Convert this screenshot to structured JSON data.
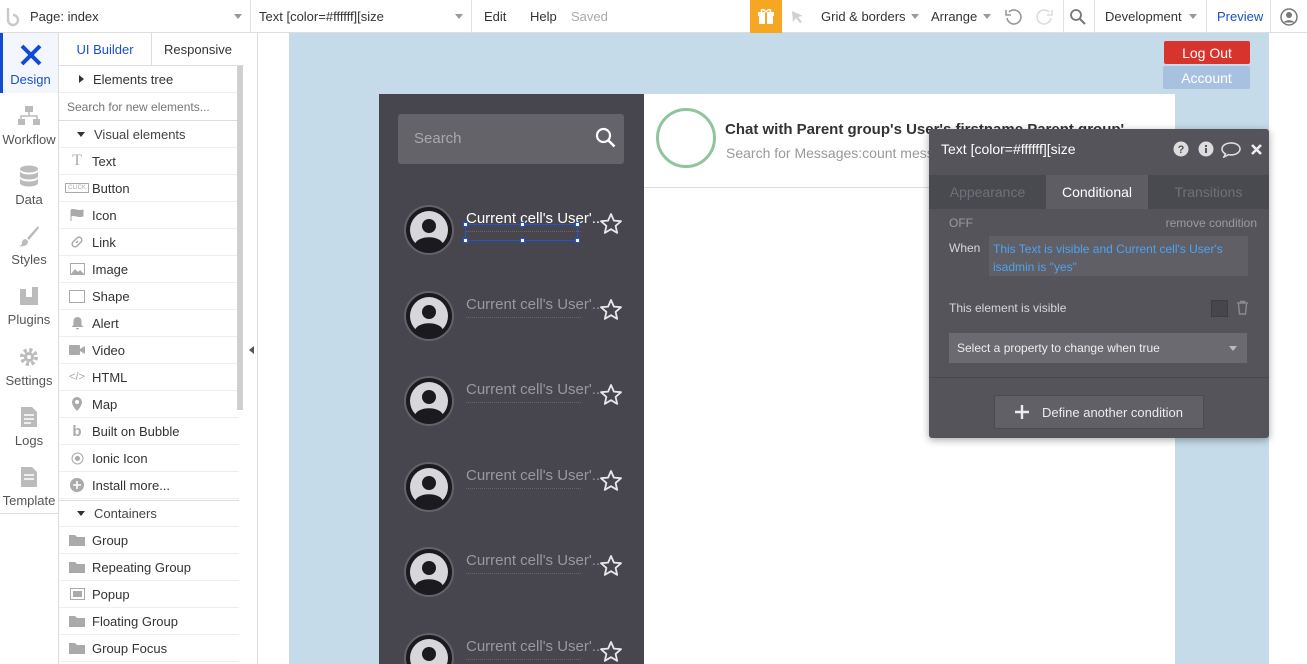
{
  "topbar": {
    "page_selector": "Page: index",
    "element_selector": "Text [color=#ffffff][size",
    "menu_edit": "Edit",
    "menu_help": "Help",
    "save_status": "Saved",
    "grid_borders": "Grid & borders",
    "arrange": "Arrange",
    "environment": "Development",
    "preview": "Preview"
  },
  "rail": {
    "items": [
      {
        "label": "Design",
        "icon": "design-icon"
      },
      {
        "label": "Workflow",
        "icon": "workflow-icon"
      },
      {
        "label": "Data",
        "icon": "database-icon"
      },
      {
        "label": "Styles",
        "icon": "brush-icon"
      },
      {
        "label": "Plugins",
        "icon": "plugin-icon"
      },
      {
        "label": "Settings",
        "icon": "gear-icon"
      },
      {
        "label": "Logs",
        "icon": "document-icon"
      },
      {
        "label": "Template",
        "icon": "template-icon"
      }
    ]
  },
  "panel": {
    "tab_ui_builder": "UI Builder",
    "tab_responsive": "Responsive",
    "elements_tree": "Elements tree",
    "search_placeholder": "Search for new elements...",
    "visual_elements_heading": "Visual elements",
    "visual_elements": [
      {
        "label": "Text",
        "icon": "T"
      },
      {
        "label": "Button",
        "icon": "CLICK"
      },
      {
        "label": "Icon",
        "icon": "flag-icon"
      },
      {
        "label": "Link",
        "icon": "link-icon"
      },
      {
        "label": "Image",
        "icon": "image-icon"
      },
      {
        "label": "Shape",
        "icon": "shape-icon"
      },
      {
        "label": "Alert",
        "icon": "bell-icon"
      },
      {
        "label": "Video",
        "icon": "video-icon"
      },
      {
        "label": "HTML",
        "icon": "code-icon"
      },
      {
        "label": "Map",
        "icon": "pin-icon"
      },
      {
        "label": "Built on Bubble",
        "icon": "bubble-logo-icon"
      },
      {
        "label": "Ionic Icon",
        "icon": "ionic-icon"
      },
      {
        "label": "Install more...",
        "icon": "plus-icon"
      }
    ],
    "containers_heading": "Containers",
    "containers": [
      {
        "label": "Group",
        "icon": "folder-icon"
      },
      {
        "label": "Repeating Group",
        "icon": "folder-icon"
      },
      {
        "label": "Popup",
        "icon": "popup-icon"
      },
      {
        "label": "Floating Group",
        "icon": "folder-icon"
      },
      {
        "label": "Group Focus",
        "icon": "folder-icon"
      }
    ]
  },
  "canvas": {
    "logout_label": "Log Out",
    "account_label": "Account",
    "search_placeholder": "Search",
    "chat_title": "Chat with Parent group's User's firstname Parent group'",
    "chat_subtitle": "Search for Messages:count messa",
    "user_rows": [
      {
        "name": "Current cell's User'..."
      },
      {
        "name": "Current cell's User'..."
      },
      {
        "name": "Current cell's User'..."
      },
      {
        "name": "Current cell's User'..."
      },
      {
        "name": "Current cell's User'..."
      },
      {
        "name": "Current cell's User'..."
      }
    ]
  },
  "inspector": {
    "title": "Text [color=#ffffff][size",
    "tabs": [
      "Appearance",
      "Conditional",
      "Transitions"
    ],
    "active_tab": "Conditional",
    "off_label": "OFF",
    "remove_condition": "remove condition",
    "when_label": "When",
    "condition_text": "This Text is visible and Current cell's User's isadmin is \"yes\"",
    "property_label": "This element is visible",
    "property_select": "Select a property to change when true",
    "define_another": "Define another condition"
  },
  "colors": {
    "accent_blue": "#1a4fc8",
    "gift_orange": "#f5a623",
    "logout_red": "#d7342d",
    "account_blue": "#a9c1e1",
    "sidebar_dark": "#47464f",
    "inspector_bg": "#54545a",
    "condition_link": "#4ea3f0"
  }
}
